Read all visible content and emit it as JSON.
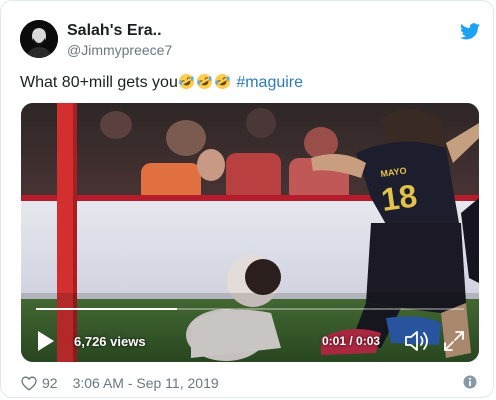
{
  "author": {
    "display_name": "Salah's Era..",
    "handle": "@Jimmypreece7"
  },
  "tweet": {
    "text_prefix": "What 80+mill gets you",
    "emoji": [
      "rolling-on-floor-laughing",
      "rolling-on-floor-laughing",
      "rolling-on-floor-laughing"
    ],
    "hashtag": "#maguire"
  },
  "video": {
    "views": "6,726 views",
    "timecode": "0:01 / 0:03",
    "progress": 0.33,
    "jersey_name": "MAYO",
    "jersey_number": "18"
  },
  "footer": {
    "likes": "92",
    "timestamp": "3:06 AM - Sep 11, 2019"
  },
  "colors": {
    "twitter_blue": "#1da1f2",
    "hashtag": "#2b7bb9",
    "muted": "#697882"
  },
  "icons": [
    "twitter-bird-icon",
    "play-icon",
    "volume-icon",
    "fullscreen-icon",
    "heart-icon",
    "info-icon"
  ]
}
